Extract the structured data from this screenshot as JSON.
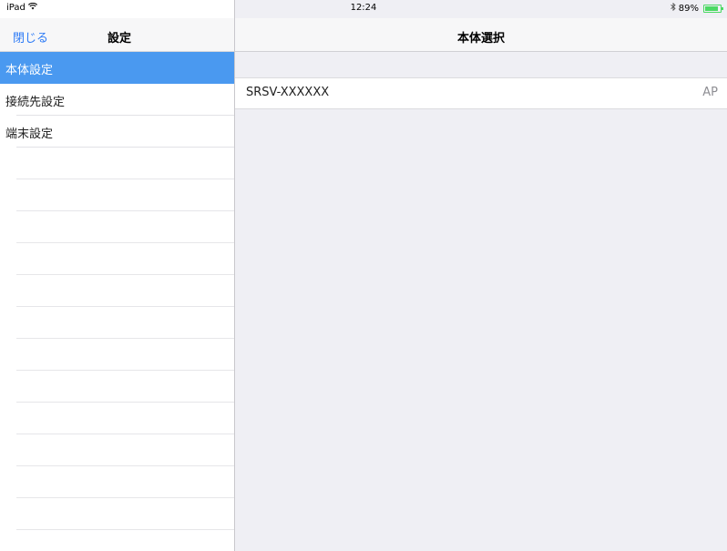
{
  "status_bar": {
    "device": "iPad",
    "time": "12:24",
    "battery": "89%",
    "battery_level": 0.89
  },
  "sidebar": {
    "close_label": "閉じる",
    "title": "設定",
    "items": [
      {
        "label": "本体設定",
        "selected": true
      },
      {
        "label": "接続先設定"
      },
      {
        "label": "端末設定"
      }
    ],
    "empty_rows": 12
  },
  "main": {
    "title": "本体選択",
    "devices": [
      {
        "name": "SRSV-XXXXXX",
        "detail": "AP"
      }
    ]
  },
  "colors": {
    "accent": "#2f7cf6",
    "selection": "#4a99f0",
    "battery": "#4cd964",
    "main_background": "#efeff4"
  }
}
